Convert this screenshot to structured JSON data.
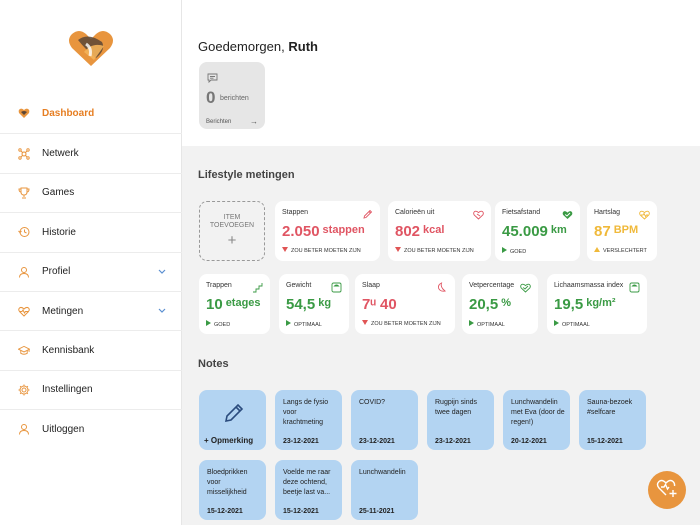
{
  "sidebar": {
    "items": [
      {
        "label": "Dashboard",
        "icon": "logo-small-icon",
        "active": true
      },
      {
        "label": "Netwerk",
        "icon": "network-icon"
      },
      {
        "label": "Games",
        "icon": "trophy-icon"
      },
      {
        "label": "Historie",
        "icon": "history-icon"
      },
      {
        "label": "Profiel",
        "icon": "user-icon",
        "expandable": true
      },
      {
        "label": "Metingen",
        "icon": "heart-icon",
        "expandable": true
      },
      {
        "label": "Kennisbank",
        "icon": "graduation-cap-icon"
      },
      {
        "label": "Instellingen",
        "icon": "gear-icon"
      },
      {
        "label": "Uitloggen",
        "icon": "user-logout-icon"
      }
    ]
  },
  "header": {
    "greeting": "Goedemorgen,",
    "name": "Ruth"
  },
  "messages": {
    "count": "0",
    "label": "berichten",
    "footer": "Berichten"
  },
  "lifestyle": {
    "title": "Lifestyle metingen",
    "add_label_1": "ITEM",
    "add_label_2": "TOEVOEGEN",
    "add_plus": "+",
    "cards": [
      {
        "name": "Stappen",
        "value": "2.050",
        "unit": "stappen",
        "status": "ZOU BETER MOETEN ZIJN",
        "color": "#e05563",
        "status_type": "down"
      },
      {
        "name": "Calorieën uit",
        "value": "802",
        "unit": "kcal",
        "status": "ZOU BETER MOETEN ZIJN",
        "color": "#e05563",
        "status_type": "down"
      },
      {
        "name": "Fietsafstand",
        "value": "45.009",
        "unit": "km",
        "status": "GOED",
        "color": "#3a9a44",
        "status_type": "good"
      },
      {
        "name": "Hartslag",
        "value": "87",
        "unit": "BPM",
        "status": "VERSLECHTERT",
        "color": "#f0b93a",
        "status_type": "up"
      },
      {
        "name": "Trappen",
        "value": "10",
        "unit": "etages",
        "status": "GOED",
        "color": "#3a9a44",
        "status_type": "good"
      },
      {
        "name": "Gewicht",
        "value": "54,5",
        "unit": "kg",
        "status": "OPTIMAAL",
        "color": "#3a9a44",
        "status_type": "good"
      },
      {
        "name": "Slaap",
        "value": "7ᵘ 40",
        "unit": "",
        "status": "ZOU BETER MOETEN ZIJN",
        "color": "#e05563",
        "status_type": "down"
      },
      {
        "name": "Vetpercentage",
        "value": "20,5",
        "unit": "%",
        "status": "OPTIMAAL",
        "color": "#3a9a44",
        "status_type": "good"
      },
      {
        "name": "Lichaamsmassa index",
        "value": "19,5",
        "unit": "kg/m²",
        "status": "OPTIMAAL",
        "color": "#3a9a44",
        "status_type": "good"
      }
    ]
  },
  "notes": {
    "title": "Notes",
    "add_label": "+ Opmerking",
    "items": [
      {
        "text": "Langs de fysio voor krachtmeting",
        "date": "23-12-2021"
      },
      {
        "text": "COVID?",
        "date": "23-12-2021"
      },
      {
        "text": "Rugpijn sinds twee dagen",
        "date": "23-12-2021"
      },
      {
        "text": "Lunchwandelin met Eva (door de regen!)",
        "date": "20-12-2021"
      },
      {
        "text": "Sauna-bezoek #selfcare",
        "date": "15-12-2021"
      },
      {
        "text": "Bloedprikken voor misselijkheid",
        "date": "15-12-2021"
      },
      {
        "text": "Voelde me raar deze ochtend, beetje last va...",
        "date": "15-12-2021"
      },
      {
        "text": "Lunchwandelin",
        "date": "25-11-2021"
      }
    ]
  },
  "colors": {
    "accent": "#e67e22",
    "note_bg": "#b3d4f2",
    "fab": "#e8953e"
  }
}
